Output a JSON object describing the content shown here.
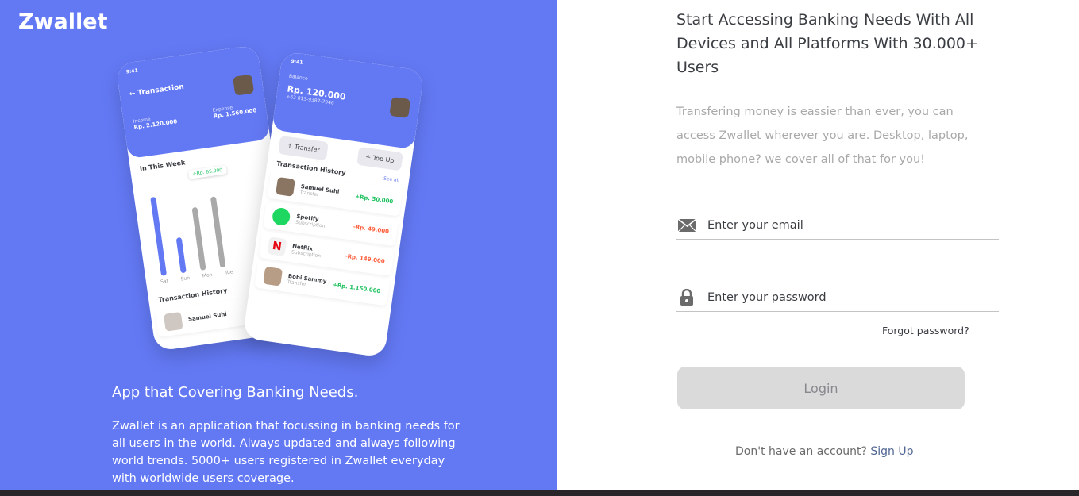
{
  "left": {
    "brand": "Zwallet",
    "title": "App that Covering Banking Needs.",
    "description": "Zwallet is an application that focussing in banking needs for all users in the world. Always updated and always following world trends. 5000+ users registered in Zwallet everyday with worldwide users coverage.",
    "phone_back": {
      "time": "9:41",
      "title": "Transaction",
      "income_label": "Income",
      "income": "Rp. 2.120.000",
      "expense_label": "Expense",
      "expense": "Rp. 1.560.000",
      "week_label": "In This Week",
      "tooltip": "+Rp. 65.000",
      "days": [
        "Sat",
        "Sun",
        "Mon",
        "Tue"
      ],
      "history_label": "Transaction History",
      "history_name": "Samuel Suhi"
    },
    "phone_front": {
      "time": "9:41",
      "balance_label": "Balance",
      "balance": "Rp. 120.000",
      "phone": "+62 813-9387-7946",
      "transfer": "Transfer",
      "topup": "Top Up",
      "history_label": "Transaction History",
      "see_all": "See all",
      "items": [
        {
          "name": "Samuel Suhi",
          "sub": "Transfer",
          "value": "+Rp. 50.000",
          "type": "pos"
        },
        {
          "name": "Spotify",
          "sub": "Subscription",
          "value": "-Rp. 49.000",
          "type": "neg"
        },
        {
          "name": "Netflix",
          "sub": "Subscription",
          "value": "-Rp. 149.000",
          "type": "neg"
        },
        {
          "name": "Bobi Sammy",
          "sub": "Transfer",
          "value": "+Rp. 1.150.000",
          "type": "pos"
        }
      ]
    }
  },
  "right": {
    "title": "Start Accessing Banking Needs With All Devices and All Platforms With 30.000+ Users",
    "description": "Transfering money is eassier than ever, you can access Zwallet wherever you are. Desktop, laptop, mobile phone? we cover all of that for you!",
    "email_placeholder": "Enter your email",
    "password_placeholder": "Enter your password",
    "forgot": "Forgot password?",
    "login": "Login",
    "no_account": "Don't have an account?",
    "signup": "Sign Up"
  },
  "colors": {
    "primary": "#6379f4",
    "positive": "#1ec15f",
    "negative": "#ff5b37"
  },
  "icons": [
    "mail-icon",
    "lock-icon"
  ]
}
